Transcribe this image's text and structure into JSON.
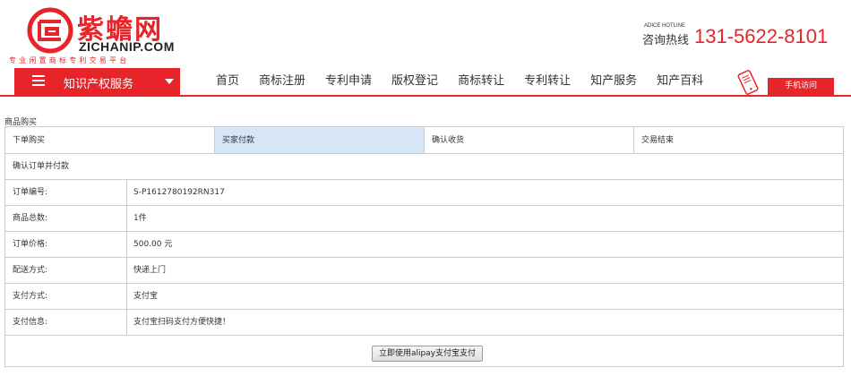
{
  "header": {
    "logo_cn": "紫蟾网",
    "logo_en": "ZICHANIP.COM",
    "logo_slogan": "专业闲置商标专利交易平台",
    "hotline_en": "ADICE HOTLINE",
    "hotline_cn": "咨询热线",
    "hotline_number": "131-5622-8101"
  },
  "nav": {
    "category_label": "知识产权服务",
    "links": [
      "首页",
      "商标注册",
      "专利申请",
      "版权登记",
      "商标转让",
      "专利转让",
      "知产服务",
      "知产百科"
    ],
    "mobile_button": "手机访问"
  },
  "content": {
    "section_title": "商品购买",
    "steps": [
      {
        "label": "下单购买",
        "active": false
      },
      {
        "label": "买家付款",
        "active": true
      },
      {
        "label": "确认收货",
        "active": false
      },
      {
        "label": "交易结束",
        "active": false
      }
    ],
    "confirm_title": "确认订单并付款",
    "details": [
      {
        "key": "订单编号:",
        "value": "S-P1612780192RN317"
      },
      {
        "key": "商品总数:",
        "value": "1件"
      },
      {
        "key": "订单价格:",
        "value": "500.00 元"
      },
      {
        "key": "配送方式:",
        "value": "快递上门"
      },
      {
        "key": "支付方式:",
        "value": "支付宝"
      },
      {
        "key": "支付信息:",
        "value": "支付宝扫码支付方便快捷！"
      }
    ],
    "pay_button": "立即使用alipay支付宝支付"
  },
  "colors": {
    "brand_red": "#e8242b",
    "active_step_bg": "#d6e6f7",
    "border": "#cccccc"
  }
}
